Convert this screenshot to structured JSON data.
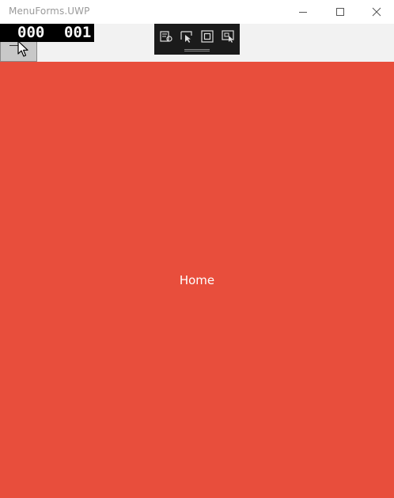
{
  "window": {
    "title": "MenuForms.UWP",
    "controls": [
      "minimize-icon",
      "maximize-icon",
      "close-icon"
    ]
  },
  "frame_counter": {
    "left_value": "000",
    "right_value": "001"
  },
  "debug_toolbar": {
    "tools": [
      "select-element-icon",
      "display-layout-adorners-icon",
      "track-focus-icon",
      "highlight-scaling-icon"
    ]
  },
  "content": {
    "page_label": "Home",
    "background": "#e84e3c"
  },
  "navbar": {
    "menu_button_icon": "hamburger-icon"
  }
}
